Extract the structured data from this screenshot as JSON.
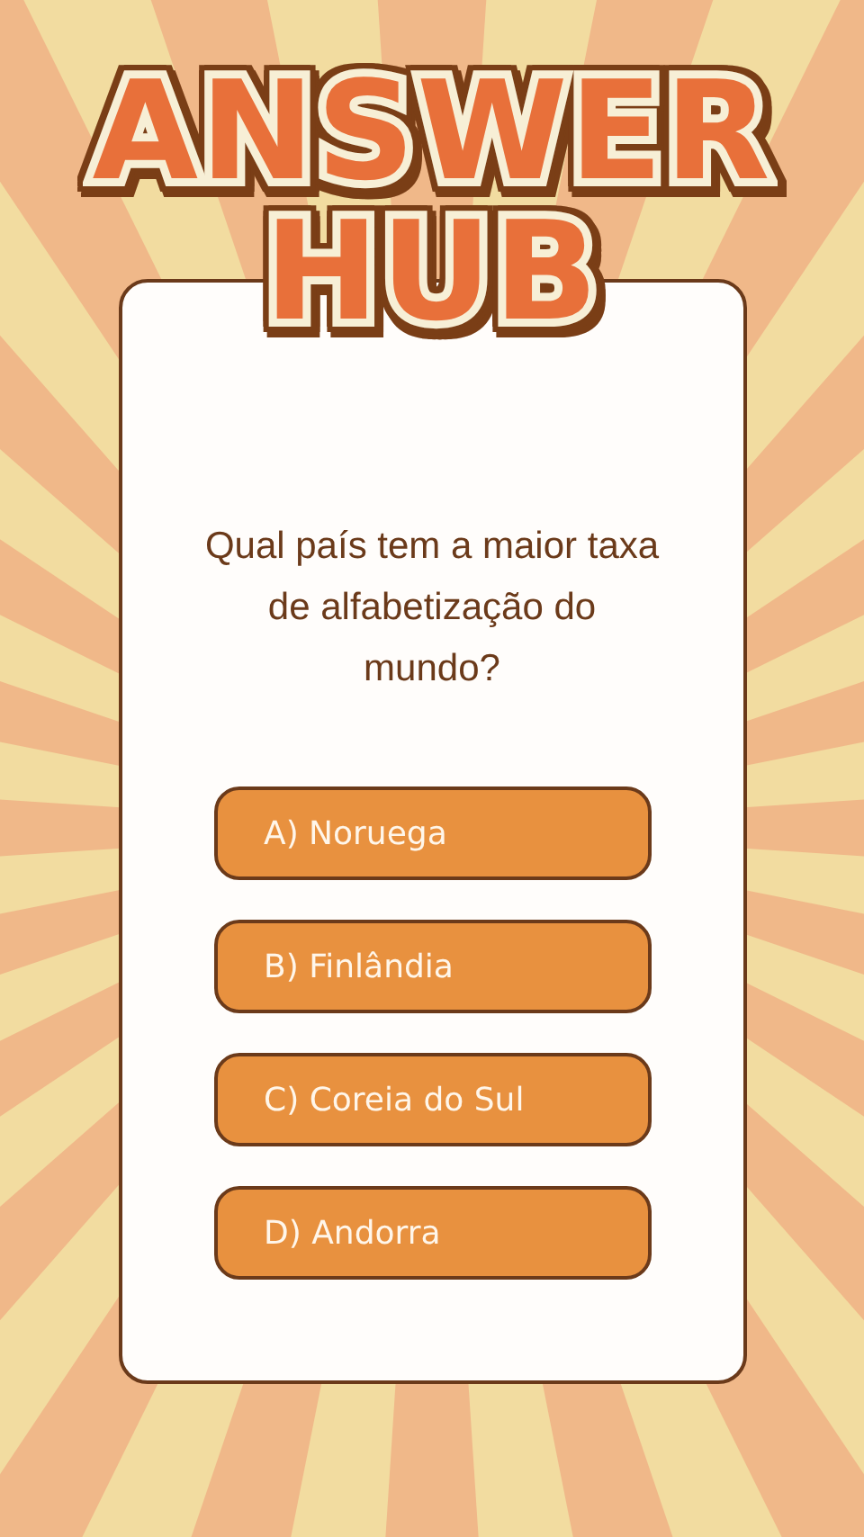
{
  "logo": {
    "lines": [
      "ANSWER",
      "HUB"
    ]
  },
  "question": "Qual país tem a maior taxa de alfabetização do mundo?",
  "answers": [
    {
      "label": "A) Noruega"
    },
    {
      "label": "B) Finlândia"
    },
    {
      "label": "C) Coreia do Sul"
    },
    {
      "label": "D) Andorra"
    }
  ]
}
